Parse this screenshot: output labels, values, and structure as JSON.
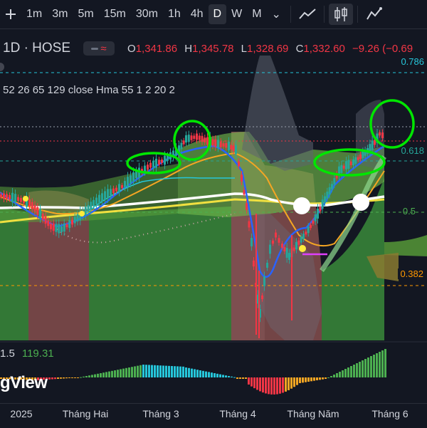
{
  "toolbar": {
    "intervals": [
      "1m",
      "3m",
      "5m",
      "15m",
      "30m",
      "1h",
      "4h",
      "D",
      "W",
      "M"
    ],
    "active_interval": "D",
    "more_label": "⌄"
  },
  "legend": {
    "symbol": "1D · HOSE",
    "open_key": "O",
    "open": "1,341.86",
    "high_key": "H",
    "high": "1,345.78",
    "low_key": "L",
    "low": "1,328.69",
    "close_key": "C",
    "close": "1,332.60",
    "change": "−9.26 (−0.69",
    "pill_glyph": "≈"
  },
  "indicator": {
    "params": "52 26 65 129 close Hma 55 1 2 20 2"
  },
  "fib_levels": [
    {
      "label": "0.786",
      "color": "#26c6da"
    },
    {
      "label": "0.618",
      "color": "#26a69a"
    },
    {
      "label": "0.5",
      "color": "#4caf50"
    },
    {
      "label": "0.382",
      "color": "#ff9800"
    }
  ],
  "oscillator": {
    "label": "1.5",
    "value": "119.31"
  },
  "watermark": "gView",
  "xaxis": {
    "ticks": [
      "2025",
      "Tháng Hai",
      "Tháng 3",
      "Tháng 4",
      "Tháng Năm",
      "Tháng 6"
    ]
  },
  "colors": {
    "background": "#131722",
    "up": "#26a69a",
    "down": "#f23645",
    "highlight_circle": "#00e600"
  },
  "icons": {
    "line_chart": "line-chart-icon",
    "candle_chart": "candle-chart-icon"
  }
}
